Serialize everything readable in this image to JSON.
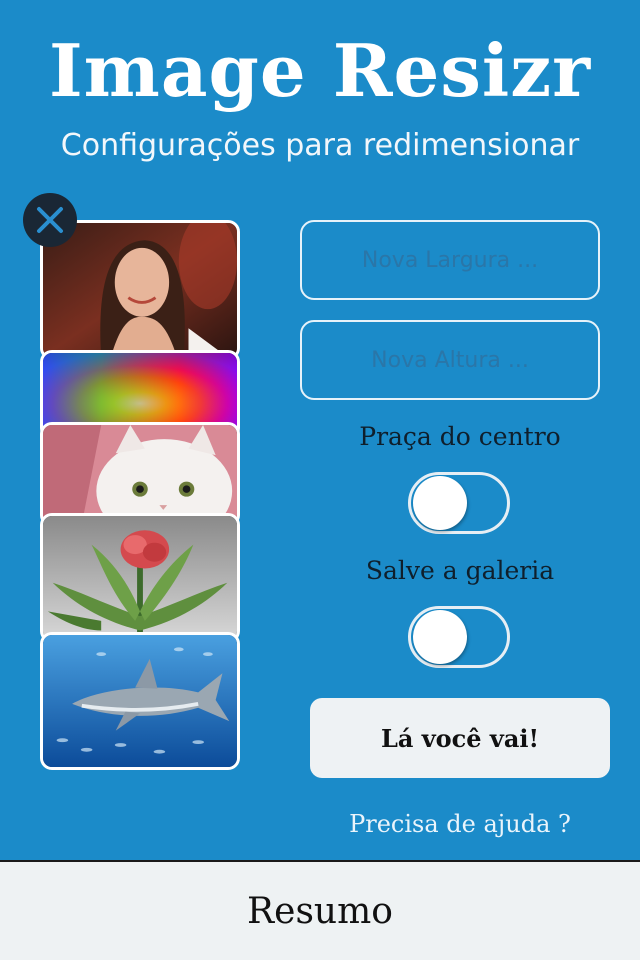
{
  "app": {
    "title": "Image Resizr",
    "subtitle": "Configurações para redimensionar"
  },
  "images": [
    {
      "name": "portrait-photo"
    },
    {
      "name": "rainbow-burst"
    },
    {
      "name": "white-kitten"
    },
    {
      "name": "red-flower-sculpture"
    },
    {
      "name": "shark-underwater"
    }
  ],
  "form": {
    "width_placeholder": "Nova Largura ...",
    "width_value": "",
    "height_placeholder": "Nova Altura ...",
    "height_value": "",
    "center_label": "Praça do centro",
    "center_on": false,
    "gallery_label": "Salve a galeria",
    "gallery_on": false,
    "submit_label": "Lá você vai!",
    "help_label": "Precisa de ajuda ?"
  },
  "bottom_bar": {
    "label": "Resumo"
  },
  "colors": {
    "background": "#1b8bc9",
    "bar": "#eef2f3",
    "button": "#eef2f4"
  },
  "icons": {
    "close": "close-icon"
  }
}
